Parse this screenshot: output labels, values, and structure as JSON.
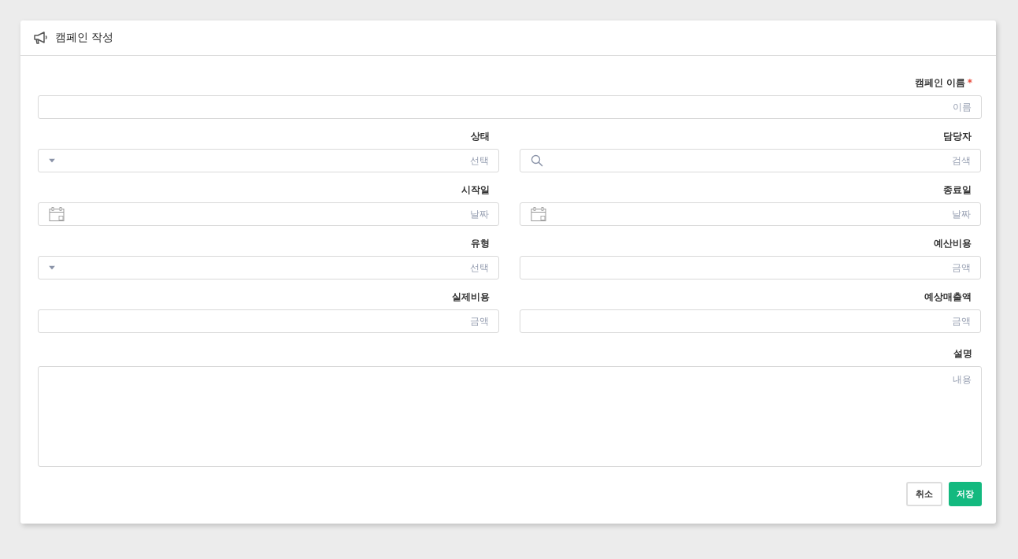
{
  "header": {
    "title": "캠페인 작성"
  },
  "name_field": {
    "label": "캠페인 이름",
    "required_mark": "*",
    "placeholder": "이름"
  },
  "fields": [
    {
      "label": "상태",
      "kind": "select",
      "placeholder": "선택"
    },
    {
      "label": "담당자",
      "kind": "search",
      "placeholder": "검색"
    },
    {
      "label": "시작일",
      "kind": "date",
      "placeholder": "날짜"
    },
    {
      "label": "종료일",
      "kind": "date",
      "placeholder": "날짜"
    },
    {
      "label": "유형",
      "kind": "select",
      "placeholder": "선택"
    },
    {
      "label": "예산비용",
      "kind": "text",
      "placeholder": "금액"
    },
    {
      "label": "실제비용",
      "kind": "text",
      "placeholder": "금액"
    },
    {
      "label": "예상매출액",
      "kind": "text",
      "placeholder": "금액"
    }
  ],
  "description": {
    "label": "설명",
    "placeholder": "내용"
  },
  "buttons": [
    {
      "label": "취소",
      "kind": "secondary"
    },
    {
      "label": "저장",
      "kind": "primary"
    }
  ]
}
